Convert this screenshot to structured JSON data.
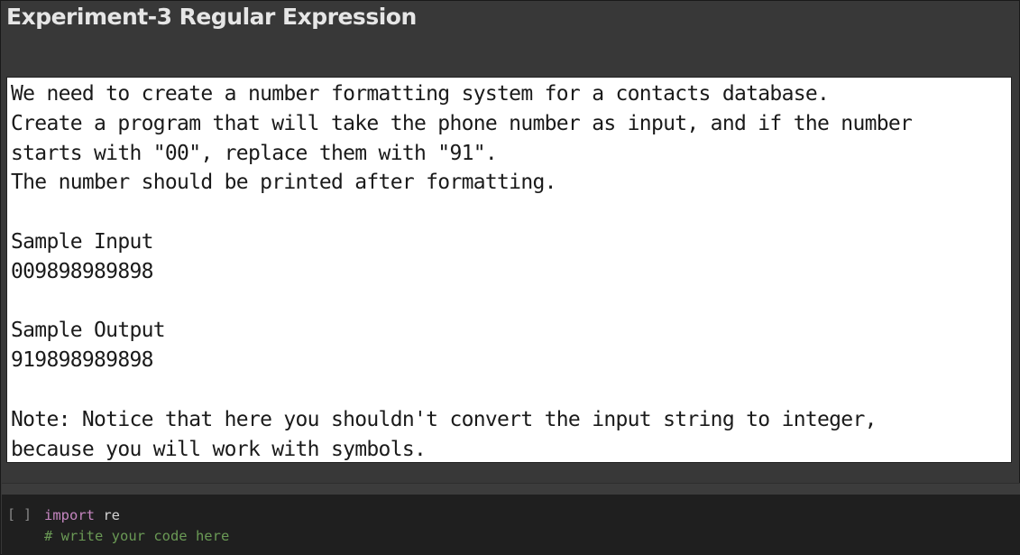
{
  "notebook": {
    "title": "Experiment-3 Regular Expression",
    "output_lines": [
      "We need to create a number formatting system for a contacts database.",
      "Create a program that will take the phone number as input, and if the number",
      "starts with \"00\", replace them with \"91\".",
      "The number should be printed after formatting.",
      "",
      "Sample Input",
      "009898989898",
      "",
      "Sample Output",
      "919898989898",
      "",
      "Note: Notice that here you shouldn't convert the input string to integer,",
      "because you will work with symbols."
    ]
  },
  "code_cell": {
    "run_button_label": "[ ]",
    "line1_keyword": "import",
    "line1_module": " re",
    "line2_comment": "# write your code here"
  },
  "colors": {
    "keyword": "#c586c0",
    "comment": "#6a9955",
    "background": "#383838",
    "cell_background": "#1f1f1f"
  }
}
